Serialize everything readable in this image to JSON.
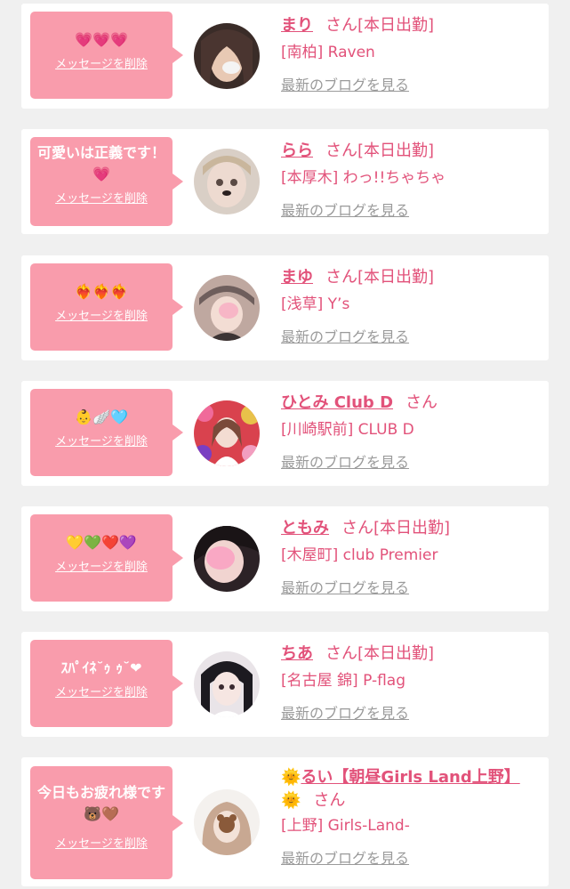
{
  "delete_label": "メッセージを削除",
  "san_label": "さん",
  "status_label": "[本日出勤]",
  "blog_label": "最新のブログを見る",
  "colors": {
    "accent": "#e2527a",
    "bubble": "#f99cac",
    "link_gray": "#9a9a9a",
    "background": "#f0f0f0"
  },
  "cards": [
    {
      "message": "💗💗💗",
      "name": "まり",
      "shop": "[南柏] Raven",
      "working_today": true
    },
    {
      "message": "可愛いは正義です！💗",
      "name": "らら",
      "shop": "[本厚木] わっ!!ちゃちゃ",
      "working_today": true
    },
    {
      "message": "❤️‍🔥❤️‍🔥❤️‍🔥",
      "name": "まゆ",
      "shop": "[浅草] Y’s",
      "working_today": true
    },
    {
      "message": "👶🪽🩵",
      "name": "ひとみ Club D",
      "shop": "[川崎駅前] CLUB D",
      "working_today": false
    },
    {
      "message": "💛💚❤️💜",
      "name": "ともみ",
      "shop": "[木屋町] club Premier",
      "working_today": true
    },
    {
      "message": "ｽﾊﾟｲﾈ˘ｩ ｩ˘❤",
      "name": "ちあ",
      "shop": "[名古屋 錦] P-flag",
      "working_today": true
    },
    {
      "message": "今日もお疲れ様です🐻🤎",
      "name": "るい【朝昼Girls Land上野】",
      "shop": "[上野] Girls-Land-",
      "working_today": false
    }
  ]
}
